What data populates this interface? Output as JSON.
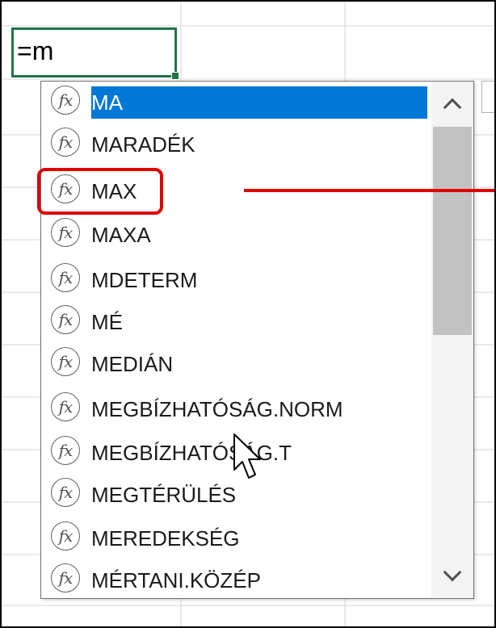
{
  "formula": {
    "cell_value": "=m"
  },
  "autocomplete": {
    "items": [
      {
        "label": "MA",
        "icon": "function-icon",
        "selected": true
      },
      {
        "label": "MARADÉK",
        "icon": "function-icon"
      },
      {
        "label": "MAX",
        "icon": "function-icon",
        "highlighted": true
      },
      {
        "label": "MAXA",
        "icon": "function-icon"
      },
      {
        "label": "MDETERM",
        "icon": "function-icon"
      },
      {
        "label": "MÉ",
        "icon": "function-icon"
      },
      {
        "label": "MEDIÁN",
        "icon": "function-icon"
      },
      {
        "label": "MEGBÍZHATÓSÁG.NORM",
        "icon": "function-icon"
      },
      {
        "label": "MEGBÍZHATÓSÁG.T",
        "icon": "function-icon"
      },
      {
        "label": "MEGTÉRÜLÉS",
        "icon": "function-icon"
      },
      {
        "label": "MEREDEKSÉG",
        "icon": "function-icon"
      },
      {
        "label": "MÉRTANI.KÖZÉP",
        "icon": "function-icon"
      }
    ],
    "fx_glyph": "fx",
    "scroll_up_icon": "chevron-up-icon",
    "scroll_down_icon": "chevron-down-icon"
  },
  "colors": {
    "selection": "#0078d7",
    "cell_border": "#217346",
    "annotation": "#e00000",
    "gridline": "#d4d4d4"
  }
}
